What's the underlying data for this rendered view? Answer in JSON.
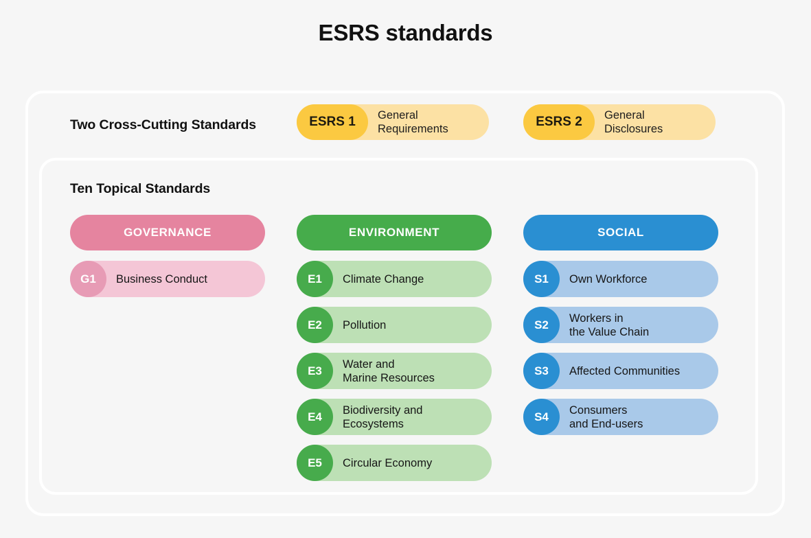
{
  "title": "ESRS standards",
  "sections": {
    "cross_cutting": {
      "label": "Two Cross-Cutting Standards",
      "items": [
        {
          "code": "ESRS 1",
          "name": "General\nRequirements"
        },
        {
          "code": "ESRS 2",
          "name": "General\nDisclosures"
        }
      ]
    },
    "topical": {
      "label": "Ten Topical Standards",
      "columns": [
        {
          "header": "GOVERNANCE",
          "header_color": "#e5849f",
          "row_color": "#f4c6d6",
          "badge_color": "#e79bb5",
          "rows": [
            {
              "code": "G1",
              "name": "Business Conduct"
            }
          ]
        },
        {
          "header": "ENVIRONMENT",
          "header_color": "#46ac4b",
          "row_color": "#bde0b5",
          "badge_color": "#47ab4c",
          "rows": [
            {
              "code": "E1",
              "name": "Climate Change"
            },
            {
              "code": "E2",
              "name": "Pollution"
            },
            {
              "code": "E3",
              "name": "Water and\nMarine Resources"
            },
            {
              "code": "E4",
              "name": "Biodiversity and\nEcosystems"
            },
            {
              "code": "E5",
              "name": "Circular Economy"
            }
          ]
        },
        {
          "header": "SOCIAL",
          "header_color": "#2a8fd2",
          "row_color": "#a9c9e9",
          "badge_color": "#2a8fd2",
          "rows": [
            {
              "code": "S1",
              "name": "Own Workforce"
            },
            {
              "code": "S2",
              "name": "Workers in\nthe Value Chain"
            },
            {
              "code": "S3",
              "name": "Affected Communities"
            },
            {
              "code": "S4",
              "name": "Consumers\nand End-users"
            }
          ]
        }
      ]
    }
  },
  "colors": {
    "background": "#f6f6f6",
    "card_border": "#ffffff",
    "esrs_badge": "#fbc941",
    "esrs_body": "#fce1a4"
  }
}
